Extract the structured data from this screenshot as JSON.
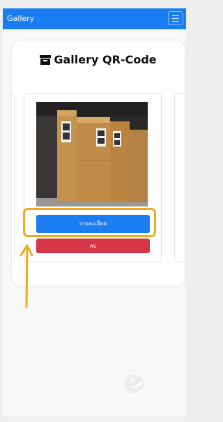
{
  "navbar": {
    "brand": "Gallery",
    "menu_icon": "hamburger-icon",
    "color": "#1a7df2"
  },
  "card": {
    "title": "Gallery QR-Code",
    "title_icon": "archive-box-icon"
  },
  "gallery": {
    "items": [
      {
        "image": "boxes-with-qr-codes-photo",
        "detail_label": "รายละเอียด",
        "delete_label": "ลบ"
      }
    ]
  },
  "colors": {
    "primary": "#1a7df2",
    "danger": "#d63447",
    "annotation": "#f4a81c"
  },
  "watermark": "e"
}
